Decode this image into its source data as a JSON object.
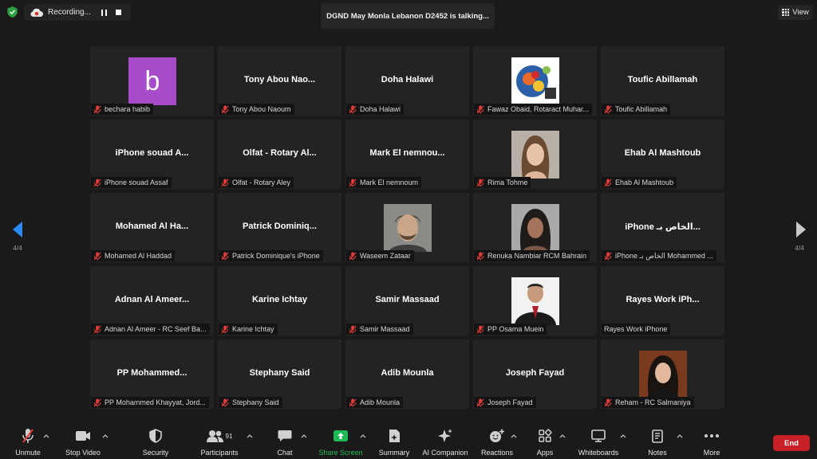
{
  "top_bar": {
    "recording_label": "Recording...",
    "talking_banner": "DGND May Monla Lebanon D2452 is talking...",
    "view_label": "View"
  },
  "pagination": {
    "left": "4/4",
    "right": "4/4"
  },
  "tiles": [
    {
      "display": "",
      "label": "bechara habib",
      "avatar_letter": "b"
    },
    {
      "display": "Tony Abou Nao...",
      "label": "Tony Abou Naoum"
    },
    {
      "display": "Doha Halawi",
      "label": "Doha Halawi"
    },
    {
      "display": "",
      "label": "Fawaz Obaid, Rotaract Muhar..."
    },
    {
      "display": "Toufic Abillamah",
      "label": "Toufic Abillamah"
    },
    {
      "display": "iPhone souad A...",
      "label": "iPhone souad Assaf"
    },
    {
      "display": "Olfat - Rotary Al...",
      "label": "Olfat - Rotary Aley"
    },
    {
      "display": "Mark El nemnou...",
      "label": "Mark El nemnoum"
    },
    {
      "display": "",
      "label": "Rima Tohme"
    },
    {
      "display": "Ehab Al Mashtoub",
      "label": "Ehab Al Mashtoub"
    },
    {
      "display": "Mohamed Al Ha...",
      "label": "Mohamed Al Haddad"
    },
    {
      "display": "Patrick Dominiq...",
      "label": "Patrick Dominique's iPhone"
    },
    {
      "display": "",
      "label": "Waseem Zataar"
    },
    {
      "display": "",
      "label": "Renuka Nambiar RCM Bahrain"
    },
    {
      "display": "iPhone الخاص بـ...",
      "label": "iPhone الخاص بـ Mohammed ..."
    },
    {
      "display": "Adnan Al Ameer...",
      "label": "Adnan Al Ameer -  RC Seef Ba..."
    },
    {
      "display": "Karine Ichtay",
      "label": "Karine Ichtay"
    },
    {
      "display": "Samir Massaad",
      "label": "Samir Massaad"
    },
    {
      "display": "",
      "label": "PP Osama Muein"
    },
    {
      "display": "Rayes Work iPh...",
      "label": "Rayes Work iPhone"
    },
    {
      "display": "PP  Mohammed...",
      "label": "PP Mohammed Khayyat, Jord..."
    },
    {
      "display": "Stephany Said",
      "label": "Stephany Said"
    },
    {
      "display": "Adib Mounla",
      "label": "Adib Mounla"
    },
    {
      "display": "Joseph Fayad",
      "label": "Joseph Fayad"
    },
    {
      "display": "",
      "label": "Reham - RC Salmaniya"
    }
  ],
  "toolbar": {
    "unmute": "Unmute",
    "stop_video": "Stop Video",
    "security": "Security",
    "participants": "Participants",
    "participants_count": "91",
    "chat": "Chat",
    "share_screen": "Share Screen",
    "summary": "Summary",
    "ai_companion": "AI Companion",
    "reactions": "Reactions",
    "apps": "Apps",
    "whiteboards": "Whiteboards",
    "notes": "Notes",
    "more": "More",
    "end": "End"
  },
  "colors": {
    "share_green": "#1db954",
    "end_red": "#c72127",
    "nav_blue": "#2d8cff",
    "avatar_purple": "#a64bc9",
    "mute_red": "#e23b3b"
  }
}
